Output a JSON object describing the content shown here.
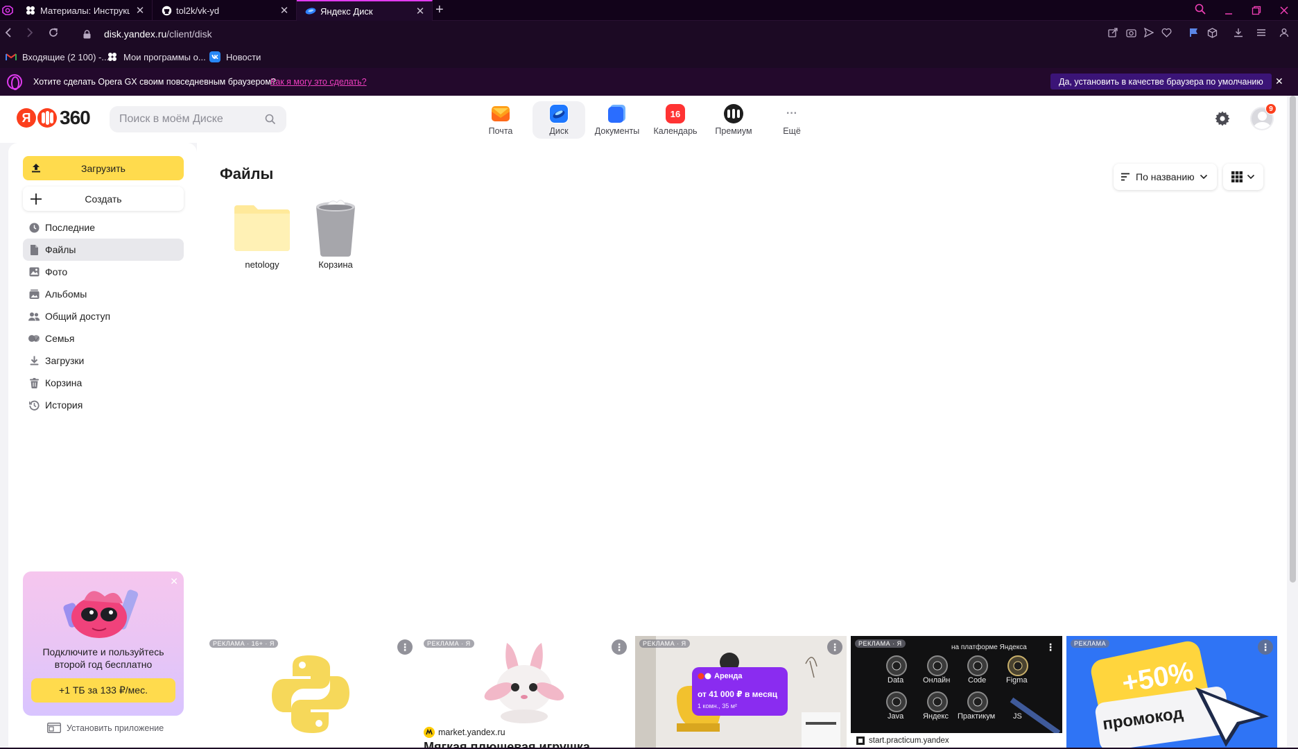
{
  "browser": {
    "tabs": [
      {
        "title": "Материалы: Инструкция д",
        "active": false
      },
      {
        "title": "tol2k/vk-yd",
        "active": false
      },
      {
        "title": "Яндекс Диск",
        "active": true
      }
    ],
    "url_host": "disk.yandex.ru",
    "url_path": "/client/disk",
    "bookmarks": [
      "Входящие (2 100) -...",
      "Мои программы о...",
      "Новости"
    ],
    "opera_prompt": {
      "question": "Хотите сделать Opera GX своим повседневным браузером?",
      "link": "Как я могу это сделать?",
      "button": "Да, установить в качестве браузера по умолчанию"
    },
    "accent_color": "#e13bf0"
  },
  "header": {
    "logo_text": "360",
    "logo_letter": "Я",
    "search_placeholder": "Поиск в моём Диске",
    "services": [
      {
        "label": "Почта",
        "icon": "mail-icon"
      },
      {
        "label": "Диск",
        "icon": "disk-icon",
        "active": true
      },
      {
        "label": "Документы",
        "icon": "documents-icon"
      },
      {
        "label": "Календарь",
        "icon": "calendar-icon",
        "day": "16"
      },
      {
        "label": "Премиум",
        "icon": "premium-icon"
      },
      {
        "label": "Ещё",
        "icon": "more-icon",
        "glyph": "···"
      }
    ],
    "notification_count": "9"
  },
  "sidebar": {
    "upload_label": "Загрузить",
    "create_label": "Создать",
    "items": [
      {
        "label": "Последние",
        "icon": "clock-icon"
      },
      {
        "label": "Файлы",
        "icon": "file-icon",
        "active": true
      },
      {
        "label": "Фото",
        "icon": "photo-icon"
      },
      {
        "label": "Альбомы",
        "icon": "album-icon"
      },
      {
        "label": "Общий доступ",
        "icon": "shared-icon"
      },
      {
        "label": "Семья",
        "icon": "family-icon"
      },
      {
        "label": "Загрузки",
        "icon": "download-icon"
      },
      {
        "label": "Корзина",
        "icon": "trash-icon"
      },
      {
        "label": "История",
        "icon": "history-icon"
      }
    ],
    "promo": {
      "text": "Подключите и пользуйтесь второй год бесплатно",
      "button": "+1 ТБ за 133 ₽/мес."
    },
    "install_app": "Установить приложение"
  },
  "main": {
    "title": "Файлы",
    "sort_label": "По названию",
    "files": [
      {
        "name": "netology",
        "type": "folder"
      },
      {
        "name": "Корзина",
        "type": "trash"
      }
    ]
  },
  "ads": [
    {
      "tag": "РЕКЛАМА · 16+ · Я"
    },
    {
      "tag": "РЕКЛАМА · Я",
      "domain": "market.yandex.ru",
      "title": "Мягкая плюшевая игрушка"
    },
    {
      "tag": "РЕКЛАМА · Я",
      "badge": "Аренда",
      "price": "от 41 000 ₽ в месяц",
      "details": "1 комн., 35 м²"
    },
    {
      "tag": "РЕКЛАМА · Я",
      "header": "на платформе Яндекса",
      "labels": [
        "Data",
        "Онлайн",
        "Code",
        "Figma",
        "Java",
        "Яндекс",
        "Практикум",
        "JS"
      ],
      "domain": "start.practicum.yandex"
    },
    {
      "tag": "РЕКЛАМА",
      "percent": "+50%",
      "word": "промокод"
    }
  ]
}
